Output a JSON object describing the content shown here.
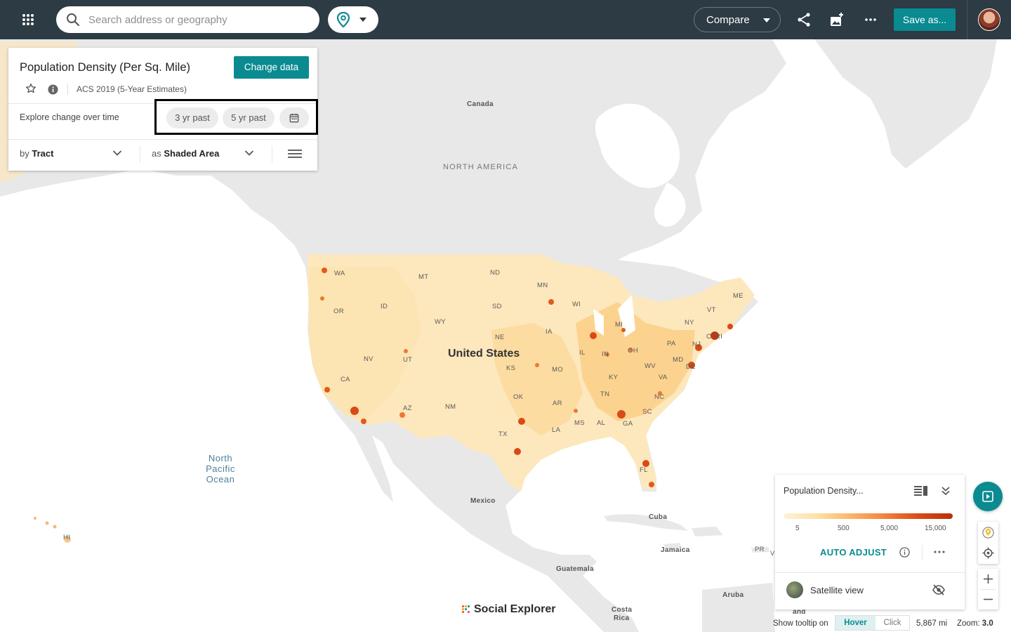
{
  "topbar": {
    "search_placeholder": "Search address or geography",
    "compare_label": "Compare",
    "save_label": "Save as..."
  },
  "data_panel": {
    "title": "Population Density (Per Sq. Mile)",
    "change_data_label": "Change data",
    "survey": "ACS 2019 (5-Year Estimates)",
    "explore_label": "Explore change over time",
    "time_options": [
      "3 yr past",
      "5 yr past"
    ],
    "by_prefix": "by",
    "by_value": "Tract",
    "as_prefix": "as",
    "as_value": "Shaded Area"
  },
  "map": {
    "labels": {
      "canada": "Canada",
      "north_america": "NORTH AMERICA",
      "united_states": "United States",
      "mexico": "Mexico",
      "cuba": "Cuba",
      "jamaica": "Jamaica",
      "guatemala": "Guatemala",
      "aruba": "Aruba",
      "costa_rica_1": "Costa",
      "costa_rica_2": "Rica",
      "pr": "PR",
      "hi": "HI",
      "ocean_1": "North",
      "ocean_2": "Pacific",
      "ocean_3": "Ocean",
      "and": "and",
      "v": "V"
    },
    "states": {
      "WA": "WA",
      "OR": "OR",
      "ID": "ID",
      "MT": "MT",
      "WY": "WY",
      "ND": "ND",
      "SD": "SD",
      "NE": "NE",
      "MN": "MN",
      "WI": "WI",
      "IA": "IA",
      "MI": "MI",
      "IL": "IL",
      "IN": "IN",
      "OH": "OH",
      "NV": "NV",
      "UT": "UT",
      "CA": "CA",
      "AZ": "AZ",
      "NM": "NM",
      "KS": "KS",
      "MO": "MO",
      "OK": "OK",
      "AR": "AR",
      "TX": "TX",
      "LA": "LA",
      "MS": "MS",
      "AL": "AL",
      "GA": "GA",
      "TN": "TN",
      "KY": "KY",
      "WV": "WV",
      "VA": "VA",
      "NC": "NC",
      "SC": "SC",
      "FL": "FL",
      "PA": "PA",
      "NY": "NY",
      "VT": "VT",
      "ME": "ME",
      "NJ": "NJ",
      "CT": "CT",
      "RI": "RI",
      "MD": "MD",
      "DE": "DE"
    },
    "brand": "Social Explorer"
  },
  "legend": {
    "title": "Population Density...",
    "ticks": [
      "5",
      "500",
      "5,000",
      "15,000"
    ],
    "gradient_colors": [
      "#fdf3d9",
      "#fde0a6",
      "#fbb46a",
      "#f2813e",
      "#d94a16",
      "#b83008"
    ],
    "auto_adjust_label": "AUTO ADJUST",
    "satellite_label": "Satellite view"
  },
  "status": {
    "tooltip_label": "Show tooltip on",
    "hover_label": "Hover",
    "click_label": "Click",
    "scale": "5,867 mi",
    "zoom_label": "Zoom:",
    "zoom_value": "3.0"
  },
  "colors": {
    "topbar_bg": "#2c3b44",
    "accent": "#0a8a91",
    "land": "#e8e8e8",
    "water": "#ffffff"
  }
}
